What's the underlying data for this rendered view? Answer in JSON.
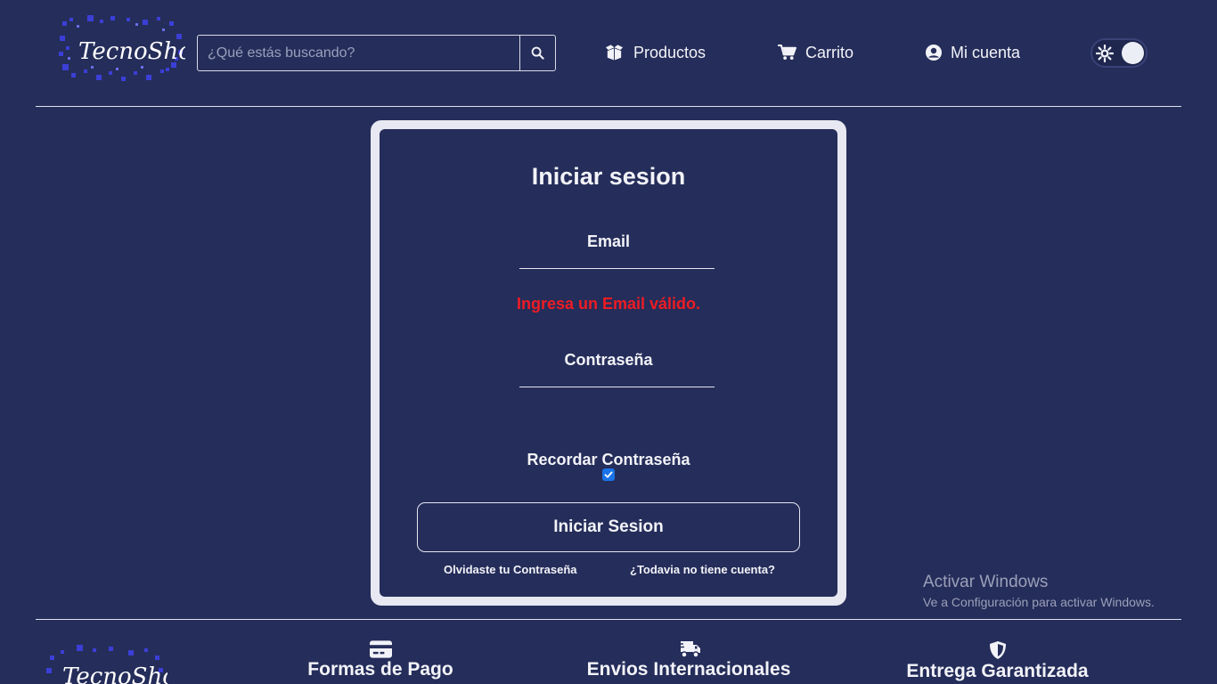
{
  "header": {
    "logo_text": "TecnoShop",
    "search": {
      "placeholder": "¿Qué estás buscando?",
      "value": ""
    },
    "nav": [
      {
        "label": "Productos",
        "icon": "box-open-icon"
      },
      {
        "label": "Carrito",
        "icon": "shopping-cart-icon"
      },
      {
        "label": "Mi cuenta",
        "icon": "user-circle-icon"
      }
    ],
    "theme_toggle": {
      "icon": "sun-icon",
      "state": "dark"
    }
  },
  "login": {
    "title": "Iniciar sesion",
    "email_label": "Email",
    "email_value": "",
    "email_error": "Ingresa un Email válido.",
    "password_label": "Contraseña",
    "password_value": "",
    "remember_label": "Recordar Contraseña",
    "remember_checked": true,
    "submit_label": "Iniciar Sesion",
    "forgot_link": "Olvidaste tu Contraseña",
    "register_link": "¿Todavia no tiene cuenta?"
  },
  "watermark": {
    "title": "Activar Windows",
    "subtitle": "Ve a Configuración para activar Windows."
  },
  "footer": {
    "logo_text": "TecnoShop",
    "features": [
      {
        "label": "Formas de Pago",
        "icon": "credit-card-icon"
      },
      {
        "label": "Envios Internacionales",
        "icon": "shipping-fast-icon"
      },
      {
        "label": "Entrega Garantizada",
        "icon": "shield-icon"
      }
    ]
  },
  "colors": {
    "background": "#252d5a",
    "card_border": "#e7e8f1",
    "error": "#ee1c24",
    "checkbox": "#1a73e8",
    "text": "#f2f3f8"
  }
}
